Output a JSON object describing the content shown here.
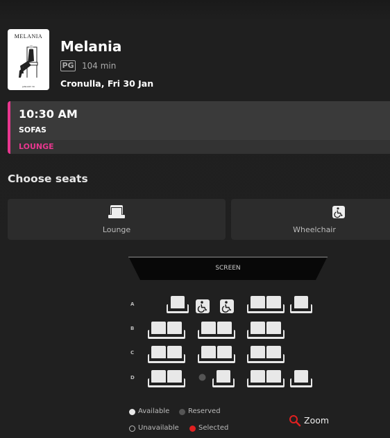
{
  "movie": {
    "poster_title": "MELANIA",
    "poster_date": "JANUARY 30",
    "title": "Melania",
    "rating": "PG",
    "duration": "104 min",
    "location": "Cronulla, Fri 30 Jan"
  },
  "session": {
    "time": "10:30 AM",
    "type": "SOFAS",
    "tag": "LOUNGE",
    "accent": "#e8378f"
  },
  "seating": {
    "heading": "Choose seats",
    "filters": [
      {
        "label": "Lounge",
        "icon": "lounge-icon"
      },
      {
        "label": "Wheelchair",
        "icon": "wheelchair-icon"
      }
    ],
    "screen_label": "SCREEN",
    "rows": [
      "A",
      "B",
      "C",
      "D"
    ]
  },
  "legend": {
    "available": "Available",
    "reserved": "Reserved",
    "unavailable": "Unavailable",
    "selected": "Selected",
    "colors": {
      "available": "#e8e8e8",
      "reserved": "#555555",
      "selected": "#e02020"
    }
  },
  "zoom": {
    "label": "Zoom",
    "icon": "magnifier-icon",
    "color": "#e02020"
  }
}
